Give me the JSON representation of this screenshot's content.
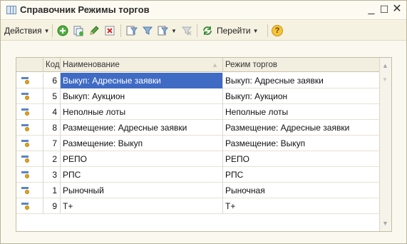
{
  "window": {
    "title": "Справочник Режимы торгов",
    "minimize": "_",
    "maximize": "☐",
    "close": "✕"
  },
  "toolbar": {
    "actions_label": "Действия",
    "goto_label": "Перейти",
    "help_label": "?"
  },
  "table": {
    "headers": {
      "code": "Код",
      "name": "Наименование",
      "mode": "Режим торгов"
    },
    "rows": [
      {
        "code": "6",
        "name": "Выкуп: Адресные заявки",
        "mode": "Выкуп: Адресные заявки"
      },
      {
        "code": "5",
        "name": "Выкуп: Аукцион",
        "mode": "Выкуп: Аукцион"
      },
      {
        "code": "4",
        "name": "Неполные лоты",
        "mode": "Неполные лоты"
      },
      {
        "code": "8",
        "name": "Размещение: Адресные заявки",
        "mode": "Размещение: Адресные заявки"
      },
      {
        "code": "7",
        "name": "Размещение: Выкуп",
        "mode": "Размещение: Выкуп"
      },
      {
        "code": "2",
        "name": "РЕПО",
        "mode": "РЕПО"
      },
      {
        "code": "3",
        "name": "РПС",
        "mode": "РПС"
      },
      {
        "code": "1",
        "name": "Рыночный",
        "mode": "Рыночная"
      },
      {
        "code": "9",
        "name": "Т+",
        "mode": "Т+"
      }
    ],
    "selected_index": 0
  },
  "colors": {
    "selection": "#3f6bc4",
    "window_bg": "#fbf9ef"
  }
}
